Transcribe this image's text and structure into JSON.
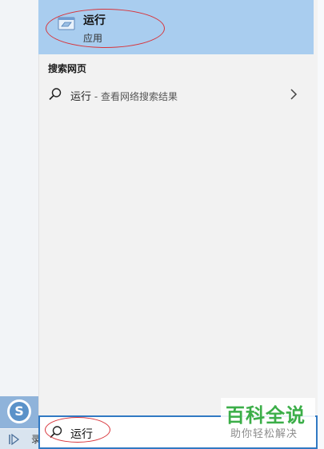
{
  "best_match": {
    "title": "运行",
    "subtitle": "应用",
    "icon": "run-dialog-icon"
  },
  "web_section": {
    "header": "搜索网页",
    "query": "运行",
    "description": " - 查看网络搜索结果",
    "icon": "search-icon",
    "arrow_icon": "chevron-right-icon"
  },
  "search_box": {
    "value": "运行",
    "icon": "search-icon"
  },
  "taskbar": {
    "partial_label": "录",
    "sogou_logo": "S"
  },
  "watermark": {
    "title": "百科全说",
    "subtitle": "助你轻松解决"
  },
  "colors": {
    "selected_bg": "#a9cdef",
    "annotation_red": "#d8343a",
    "search_border": "#3179c3",
    "watermark_green": "#3bae48"
  }
}
